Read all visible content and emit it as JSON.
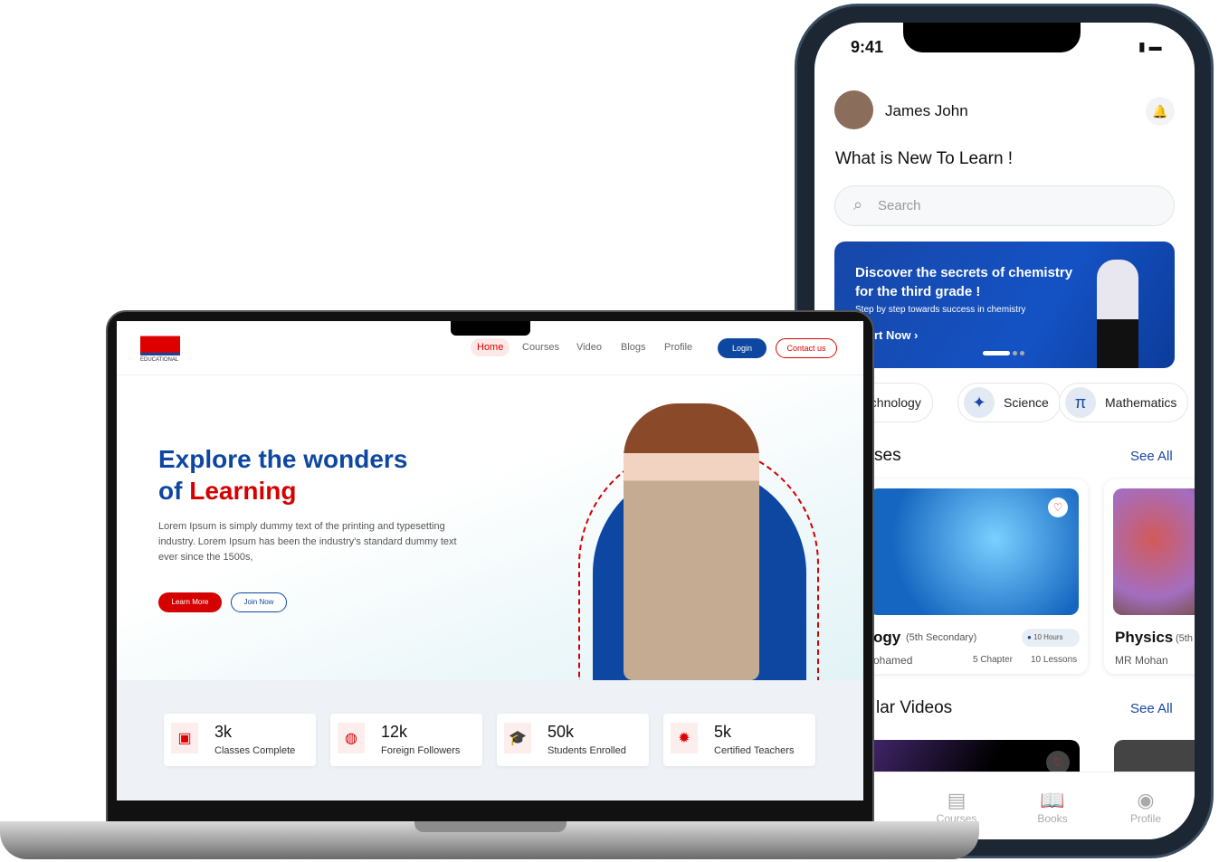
{
  "phone": {
    "time": "9:41",
    "user_name": "James John",
    "heading": "What is New To Learn !",
    "search_placeholder": "Search",
    "banner": {
      "title": "Discover the secrets of chemistry for the third grade !",
      "subtitle": "Step by step towards success in chemistry",
      "cta": "rt Now ›"
    },
    "categories": [
      {
        "label": "Technology",
        "icon": "laptop-icon"
      },
      {
        "label": "Science",
        "icon": "dna-icon"
      },
      {
        "label": "Mathematics",
        "icon": "pi-icon",
        "glyph": "π"
      }
    ],
    "courses_heading": "ses",
    "see_all": "See All",
    "courses": [
      {
        "title": "ogy",
        "grade": "(5th Secondary)",
        "hours": "10 Hours",
        "teacher": "ohamed",
        "chapters": "5 Chapter",
        "lessons": "10 Lessons"
      },
      {
        "title": "Physics",
        "grade": "(5th",
        "teacher": "MR Mohan"
      }
    ],
    "videos_heading": "lar Videos",
    "tabs": [
      {
        "label": "Courses",
        "icon": "courses-icon"
      },
      {
        "label": "Books",
        "icon": "book-icon"
      },
      {
        "label": "Profile",
        "icon": "profile-icon"
      }
    ]
  },
  "laptop": {
    "logo_text": "EDUCATIONAL",
    "nav": [
      "Home",
      "Courses",
      "Video",
      "Blogs",
      "Profile"
    ],
    "login": "Login",
    "contact": "Contact us",
    "hero_line1": "Explore the wonders",
    "hero_line2_a": "of ",
    "hero_line2_b": "Learning",
    "hero_text": "Lorem Ipsum is simply dummy text of the printing and typesetting industry. Lorem Ipsum has been the industry's standard dummy text ever since the 1500s,",
    "learn_more": "Learn More",
    "join_now": "Join Now",
    "stats": [
      {
        "value": "3k",
        "label": "Classes Complete",
        "icon": "laptop-code-icon"
      },
      {
        "value": "12k",
        "label": "Foreign Followers",
        "icon": "globe-icon"
      },
      {
        "value": "50k",
        "label": "Students Enrolled",
        "icon": "graduate-icon"
      },
      {
        "value": "5k",
        "label": "Certified Teachers",
        "icon": "certified-badge-icon"
      }
    ]
  },
  "colors": {
    "brand_blue": "#0d47a1",
    "brand_red": "#d50000"
  }
}
